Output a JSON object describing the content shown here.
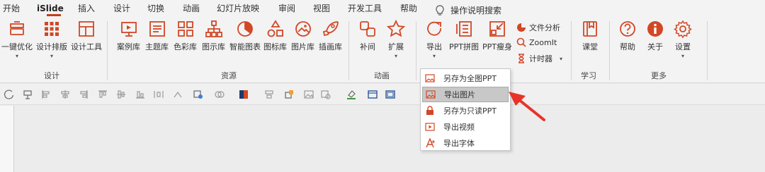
{
  "tabs": [
    {
      "label": "开始"
    },
    {
      "label": "iSlide"
    },
    {
      "label": "插入"
    },
    {
      "label": "设计"
    },
    {
      "label": "切换"
    },
    {
      "label": "动画"
    },
    {
      "label": "幻灯片放映"
    },
    {
      "label": "审阅"
    },
    {
      "label": "视图"
    },
    {
      "label": "开发工具"
    },
    {
      "label": "帮助"
    }
  ],
  "active_tab": "iSlide",
  "tell_me": {
    "label": "操作说明搜索",
    "icon": "lightbulb-icon"
  },
  "groups": {
    "design": {
      "label": "设计",
      "buttons": [
        {
          "label": "一键优化",
          "icon": "one-click-optimize-icon",
          "has_menu": true
        },
        {
          "label": "设计排版",
          "icon": "layout-grid-icon",
          "has_menu": true
        },
        {
          "label": "设计工具",
          "icon": "design-tools-icon",
          "has_menu": false
        }
      ]
    },
    "resources": {
      "label": "资源",
      "buttons": [
        {
          "label": "案例库",
          "icon": "case-library-icon"
        },
        {
          "label": "主题库",
          "icon": "theme-library-icon"
        },
        {
          "label": "色彩库",
          "icon": "color-library-icon"
        },
        {
          "label": "图示库",
          "icon": "diagram-library-icon"
        },
        {
          "label": "智能图表",
          "icon": "smart-chart-icon"
        },
        {
          "label": "图标库",
          "icon": "icon-library-icon"
        },
        {
          "label": "图片库",
          "icon": "picture-library-icon"
        },
        {
          "label": "插画库",
          "icon": "illustration-library-icon"
        }
      ]
    },
    "animation": {
      "label": "动画",
      "buttons": [
        {
          "label": "补间",
          "icon": "tween-icon"
        },
        {
          "label": "扩展",
          "icon": "star-extend-icon",
          "has_menu": true
        }
      ]
    },
    "tools": {
      "buttons": [
        {
          "label": "导出",
          "icon": "export-icon",
          "has_menu": true,
          "pressed": true
        },
        {
          "label": "PPT拼图",
          "icon": "ppt-collage-icon"
        },
        {
          "label": "PPT瘦身",
          "icon": "ppt-slim-icon"
        }
      ],
      "small_buttons": [
        {
          "label": "文件分析",
          "icon": "pie-analysis-icon"
        },
        {
          "label": "ZoomIt",
          "icon": "zoom-icon"
        },
        {
          "label": "计时器",
          "icon": "hourglass-icon",
          "has_menu": true
        }
      ]
    },
    "learning": {
      "label": "学习",
      "buttons": [
        {
          "label": "课堂",
          "icon": "classroom-icon"
        }
      ]
    },
    "more": {
      "label": "更多",
      "buttons": [
        {
          "label": "帮助",
          "icon": "help-icon"
        },
        {
          "label": "关于",
          "icon": "info-icon"
        },
        {
          "label": "设置",
          "icon": "settings-gear-icon"
        }
      ]
    }
  },
  "export_menu": {
    "items": [
      {
        "label": "另存为全图PPT",
        "icon": "save-as-image-ppt-icon"
      },
      {
        "label": "导出图片",
        "icon": "export-image-icon",
        "highlighted": true
      },
      {
        "label": "另存为只读PPT",
        "icon": "save-readonly-ppt-icon"
      },
      {
        "label": "导出视频",
        "icon": "export-video-icon"
      },
      {
        "label": "导出字体",
        "icon": "export-font-icon"
      }
    ]
  },
  "colors": {
    "accent": "#c43e1c",
    "icon_red": "#d24726",
    "arrow": "#e8332a",
    "ribbon_bg": "#f3f3f3",
    "menu_hover": "#c8c8c8"
  }
}
